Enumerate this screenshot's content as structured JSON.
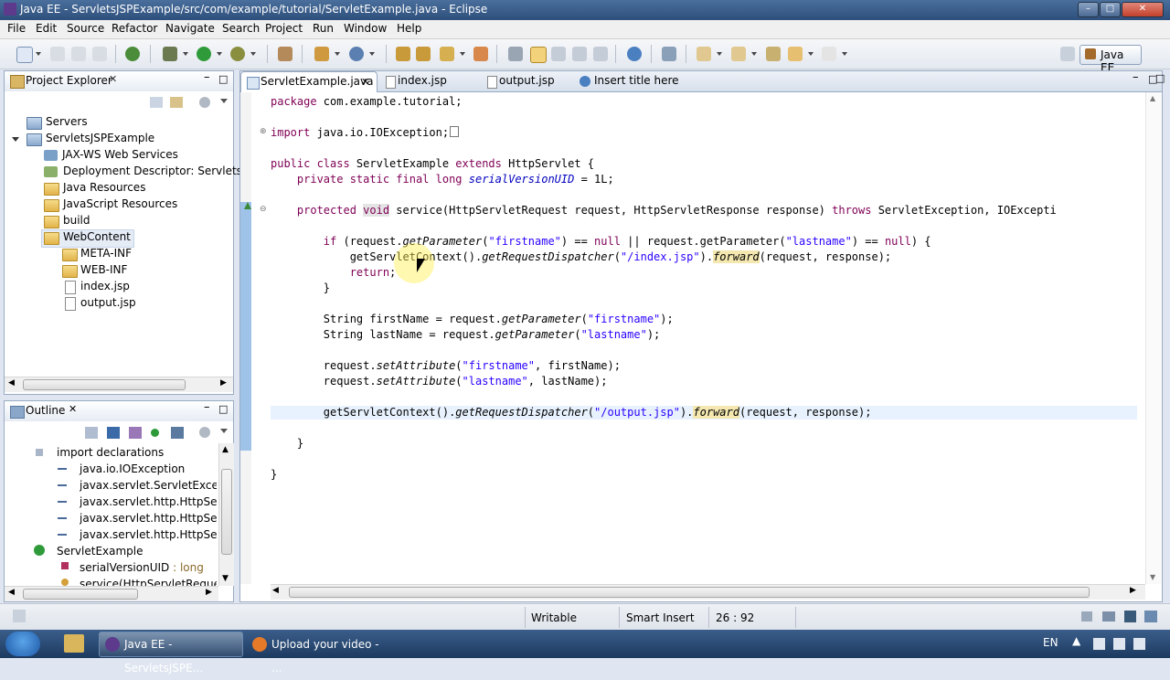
{
  "window": {
    "title": "Java EE - ServletsJSPExample/src/com/example/tutorial/ServletExample.java - Eclipse"
  },
  "menu": [
    "File",
    "Edit",
    "Source",
    "Refactor",
    "Navigate",
    "Search",
    "Project",
    "Run",
    "Window",
    "Help"
  ],
  "perspective": "Java EE",
  "project_explorer": {
    "title": "Project Explorer",
    "items": [
      "Servers",
      "ServletsJSPExample",
      "JAX-WS Web Services",
      "Deployment Descriptor: ServletsJSP",
      "Java Resources",
      "JavaScript Resources",
      "build",
      "WebContent",
      "META-INF",
      "WEB-INF",
      "index.jsp",
      "output.jsp"
    ]
  },
  "outline": {
    "title": "Outline",
    "items": [
      "import declarations",
      "java.io.IOException",
      "javax.servlet.ServletException",
      "javax.servlet.http.HttpServlet",
      "javax.servlet.http.HttpServlet",
      "javax.servlet.http.HttpServlet",
      "ServletExample",
      "serialVersionUID",
      ": long",
      "service(HttpServletRequest, H"
    ]
  },
  "editor": {
    "tabs": [
      "ServletExample.java",
      "index.jsp",
      "output.jsp",
      "Insert title here"
    ],
    "code": {
      "l1a": "package",
      "l1b": " com.example.tutorial;",
      "l2a": "import",
      "l2b": " java.io.IOException;",
      "l3a": "public class",
      "l3b": " ServletExample ",
      "l3c": "extends",
      "l3d": " HttpServlet {",
      "l4a": "    private static final long",
      "l4b": " ",
      "l4c": "serialVersionUID",
      "l4d": " = ",
      "l4e": "1L",
      "l4f": ";",
      "l5a": "    protected",
      "l5b": " ",
      "l5c": "void",
      "l5d": " service(HttpServletRequest request, HttpServletResponse response) ",
      "l5e": "throws",
      "l5f": " ServletException, IOExcepti",
      "l6a": "        if",
      "l6b": " (request.",
      "l6c": "getParameter",
      "l6d": "(",
      "l6e": "\"firstname\"",
      "l6f": ") == ",
      "l6g": "null",
      "l6h": " || request.getParameter(",
      "l6i": "\"lastname\"",
      "l6j": ") == ",
      "l6k": "null",
      "l6l": ") {",
      "l7a": "            getServletContext().",
      "l7b": "getRequestDispatcher",
      "l7c": "(",
      "l7d": "\"/index.jsp\"",
      "l7e": ").",
      "l7f": "forward",
      "l7g": "(request, response);",
      "l8a": "            return",
      "l8b": ";",
      "l9": "        }",
      "l10a": "        String firstName = request.",
      "l10b": "getParameter",
      "l10c": "(",
      "l10d": "\"firstname\"",
      "l10e": ");",
      "l11a": "        String lastName = request.",
      "l11b": "getParameter",
      "l11c": "(",
      "l11d": "\"lastname\"",
      "l11e": ");",
      "l12a": "        request.",
      "l12b": "setAttribute",
      "l12c": "(",
      "l12d": "\"firstname\"",
      "l12e": ", firstName);",
      "l13a": "        request.",
      "l13b": "setAttribute",
      "l13c": "(",
      "l13d": "\"lastname\"",
      "l13e": ", lastName);",
      "l14a": "        getServletContext().",
      "l14b": "getRequestDispatcher",
      "l14c": "(",
      "l14d": "\"/output.jsp\"",
      "l14e": ").",
      "l14f": "forward",
      "l14g": "(request, response);",
      "l15": "    }",
      "l16": "}"
    }
  },
  "status": {
    "writable": "Writable",
    "insert": "Smart Insert",
    "position": "26 : 92"
  },
  "taskbar": {
    "items": [
      "Java EE - ServletsJSPE...",
      "Upload your video - ..."
    ],
    "lang": "EN"
  }
}
